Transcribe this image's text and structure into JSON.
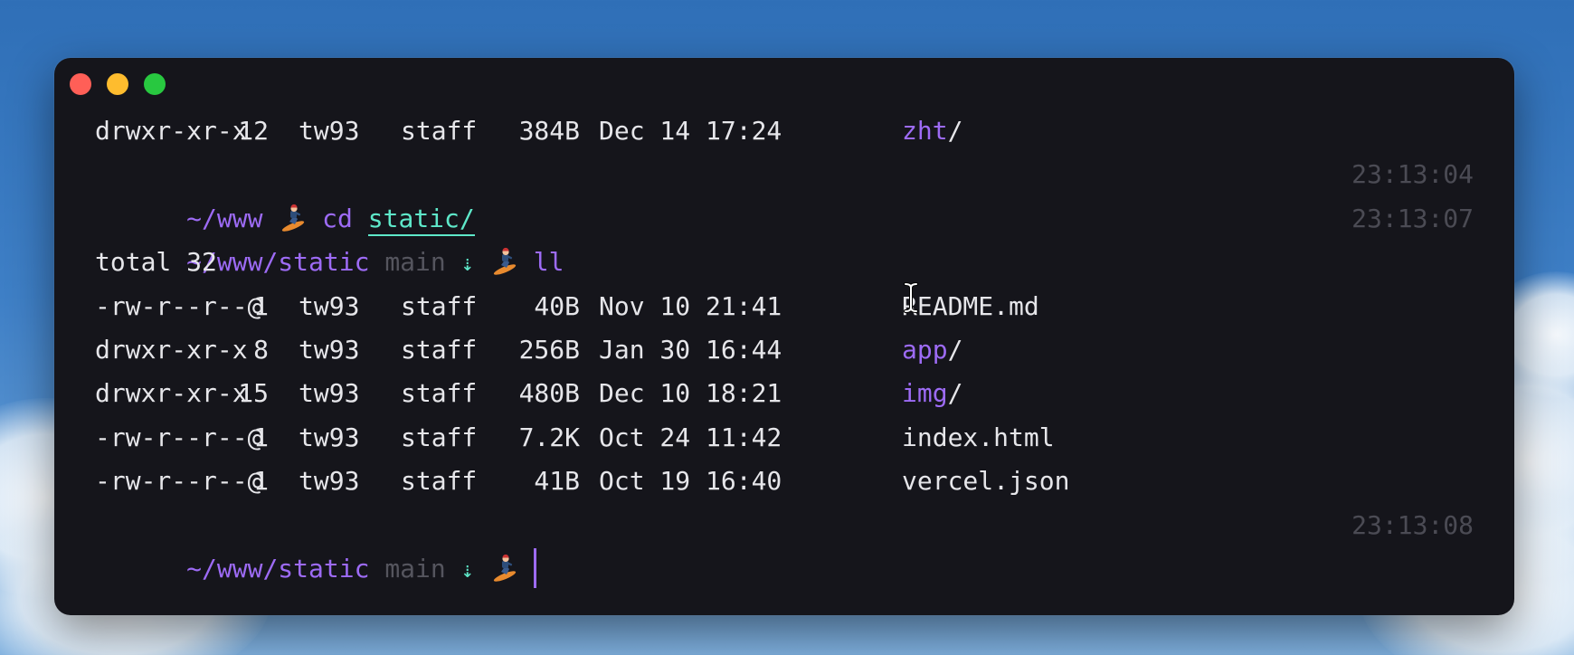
{
  "window": {
    "controls": [
      "close",
      "minimize",
      "zoom"
    ]
  },
  "terminal": {
    "top_line": {
      "perm": "drwxr-xr-x",
      "links": "12",
      "owner": "tw93",
      "group": "staff",
      "size": "384B",
      "date": "Dec 14 17:24",
      "name": "zht",
      "slash": "/"
    },
    "prompt1": {
      "path": "~/www",
      "command": "cd",
      "argument": "static/",
      "timestamp": "23:13:04"
    },
    "prompt2": {
      "path": "~/www/static",
      "branch": "main",
      "arrow": "⇣",
      "command": "ll",
      "timestamp": "23:13:07"
    },
    "total": "total 32",
    "rows": [
      {
        "perm": "-rw-r--r--@",
        "links": "1",
        "owner": "tw93",
        "group": "staff",
        "size": "40B",
        "date": "Nov 10 21:41",
        "name": "README.md",
        "slash": ""
      },
      {
        "perm": "drwxr-xr-x",
        "links": "8",
        "owner": "tw93",
        "group": "staff",
        "size": "256B",
        "date": "Jan 30 16:44",
        "name": "app",
        "slash": "/"
      },
      {
        "perm": "drwxr-xr-x",
        "links": "15",
        "owner": "tw93",
        "group": "staff",
        "size": "480B",
        "date": "Dec 10 18:21",
        "name": "img",
        "slash": "/"
      },
      {
        "perm": "-rw-r--r--@",
        "links": "1",
        "owner": "tw93",
        "group": "staff",
        "size": "7.2K",
        "date": "Oct 24 11:42",
        "name": "index.html",
        "slash": ""
      },
      {
        "perm": "-rw-r--r--@",
        "links": "1",
        "owner": "tw93",
        "group": "staff",
        "size": "41B",
        "date": "Oct 19 16:40",
        "name": "vercel.json",
        "slash": ""
      }
    ],
    "prompt3": {
      "path": "~/www/static",
      "branch": "main",
      "arrow": "⇣",
      "timestamp": "23:13:08"
    }
  },
  "colors": {
    "accent_purple": "#9d6bf5",
    "accent_teal": "#5ee8c9",
    "terminal_bg": "#15151b",
    "text": "#e6e6ea",
    "timestamp": "#4b4b54"
  },
  "icons": {
    "prompt_emoji": "snowboarder-icon",
    "mouse_cursor": "text-cursor-icon"
  }
}
